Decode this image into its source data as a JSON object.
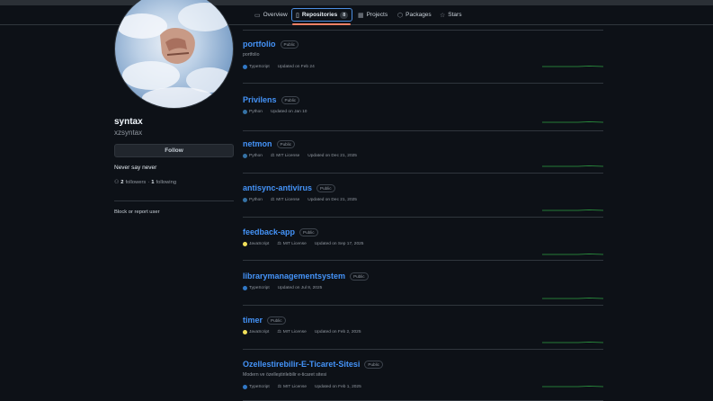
{
  "nav": {
    "tabs": [
      {
        "label": "Overview",
        "icon": "book-icon"
      },
      {
        "label": "Repositories",
        "icon": "repo-icon",
        "count": "8",
        "active": true
      },
      {
        "label": "Projects",
        "icon": "table-icon"
      },
      {
        "label": "Packages",
        "icon": "package-icon"
      },
      {
        "label": "Stars",
        "icon": "star-icon"
      }
    ]
  },
  "profile": {
    "name": "syntax",
    "username": "xzsyntax",
    "follow_label": "Follow",
    "bio": "Never say never",
    "followers_count": "2",
    "followers_label": "followers",
    "separator": "·",
    "following_count": "1",
    "following_label": "following",
    "block_label": "Block or report user"
  },
  "colors": {
    "typescript": "#3178c6",
    "python": "#3572a5",
    "javascript": "#f1e05a",
    "link": "#4493f8",
    "spark": "#2ea043"
  },
  "repos": [
    {
      "name": "portfolio",
      "visibility": "Public",
      "description": "portfolio",
      "language": "TypeScript",
      "license": "",
      "updated": "Updated on Feb 24"
    },
    {
      "name": "Privilens",
      "visibility": "Public",
      "description": "",
      "language": "Python",
      "license": "",
      "updated": "Updated on Jan 10"
    },
    {
      "name": "netmon",
      "visibility": "Public",
      "description": "",
      "language": "Python",
      "license": "MIT License",
      "updated": "Updated on Dec 21, 2025"
    },
    {
      "name": "antisync-antivirus",
      "visibility": "Public",
      "description": "",
      "language": "Python",
      "license": "MIT License",
      "updated": "Updated on Dec 21, 2025"
    },
    {
      "name": "feedback-app",
      "visibility": "Public",
      "description": "",
      "language": "JavaScript",
      "license": "MIT License",
      "updated": "Updated on Sep 17, 2025"
    },
    {
      "name": "librarymanagementsystem",
      "visibility": "Public",
      "description": "",
      "language": "TypeScript",
      "license": "",
      "updated": "Updated on Jul 8, 2025"
    },
    {
      "name": "timer",
      "visibility": "Public",
      "description": "",
      "language": "JavaScript",
      "license": "MIT License",
      "updated": "Updated on Feb 2, 2025"
    },
    {
      "name": "Ozellestirebilir-E-Ticaret-Sitesi",
      "visibility": "Public",
      "description": "Modern ve özelleştirilebilir e-ticaret sitesi",
      "language": "TypeScript",
      "license": "MIT License",
      "updated": "Updated on Feb 1, 2025"
    }
  ]
}
